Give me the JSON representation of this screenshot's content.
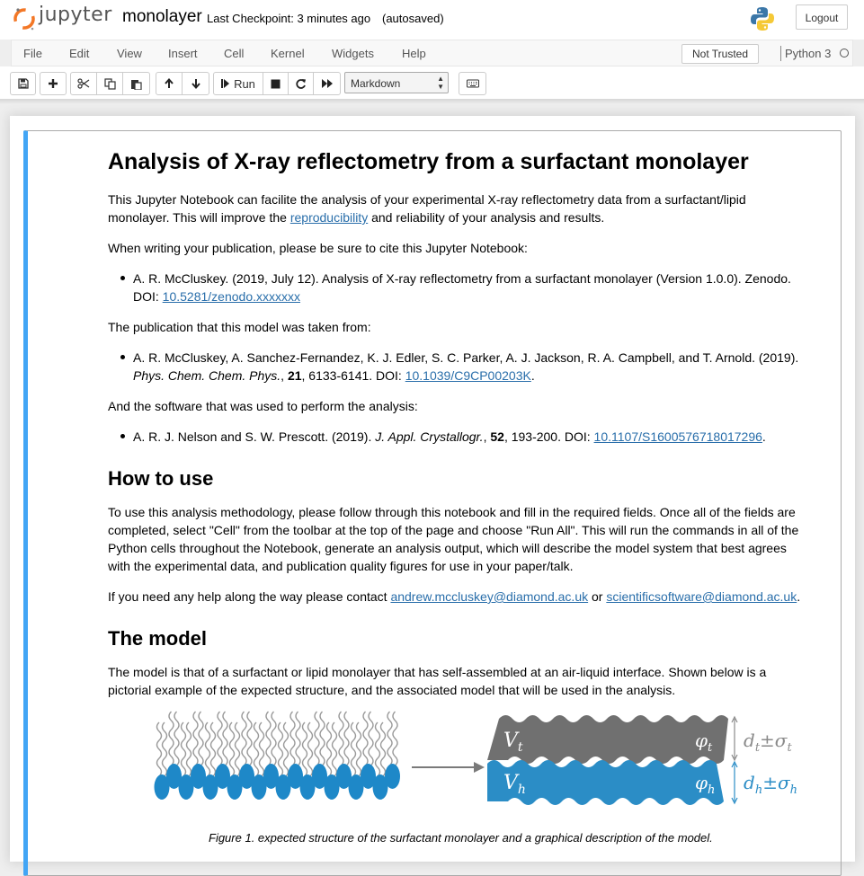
{
  "header": {
    "logo_text": "jupyter",
    "notebook_name": "monolayer",
    "checkpoint": "Last Checkpoint: 3 minutes ago",
    "autosave": "(autosaved)",
    "logout_label": "Logout"
  },
  "menubar": {
    "items": [
      "File",
      "Edit",
      "View",
      "Insert",
      "Cell",
      "Kernel",
      "Widgets",
      "Help"
    ],
    "trusted_label": "Not Trusted",
    "kernel_name": "Python 3"
  },
  "toolbar": {
    "run_label": "Run",
    "cell_type": "Markdown",
    "icons": [
      "save-icon",
      "add-cell-icon",
      "cut-icon",
      "copy-icon",
      "paste-icon",
      "move-up-icon",
      "move-down-icon",
      "run-icon",
      "stop-icon",
      "restart-icon",
      "fast-forward-icon",
      "keyboard-icon"
    ]
  },
  "markdown": {
    "title": "Analysis of X-ray reflectometry from a surfactant monolayer",
    "intro_a": "This Jupyter Notebook can facilite the analysis of your experimental X-ray reflectometry data from a surfactant/lipid",
    "intro_b_pre": "monolayer. This will improve the ",
    "intro_link": "reproducibility",
    "intro_b_post": " and reliability of your analysis and results.",
    "cite_intro": "When writing your publication, please be sure to cite this Jupyter Notebook:",
    "cite1_a": "A. R. McCluskey. (2019, July 12). Analysis of X-ray reflectometry from a surfactant monolayer (Version 1.0.0). Zenodo.",
    "cite1_b_pre": "DOI: ",
    "cite1_doi": "10.5281/zenodo.xxxxxxx",
    "model_intro": "The publication that this model was taken from:",
    "cite2_a": "A. R. McCluskey, A. Sanchez-Fernandez, K. J. Edler, S. C. Parker, A. J. Jackson, R. A. Campbell, and T. Arnold. (2019).",
    "cite2_journal": "Phys. Chem. Chem. Phys.",
    "cite2_sep": ", ",
    "cite2_vol": "21",
    "cite2_pages": ", 6133-6141. DOI: ",
    "cite2_doi": "10.1039/C9CP00203K",
    "cite2_end": ".",
    "software_intro": "And the software that was used to perform the analysis:",
    "cite3_pre": "A. R. J. Nelson and S. W. Prescott. (2019). ",
    "cite3_journal": "J. Appl. Crystallogr.",
    "cite3_sep": ", ",
    "cite3_vol": "52",
    "cite3_pages": ", 193-200. DOI: ",
    "cite3_doi": "10.1107/S1600576718017296",
    "cite3_end": ".",
    "howto_heading": "How to use",
    "howto_l1": "To use this analysis methodology, please follow through this notebook and fill in the required fields. Once all of the fields are",
    "howto_l2": "completed, select \"Cell\" from the toolbar at the top of the page and choose \"Run All\". This will run the commands in all of the",
    "howto_l3": "Python cells throughout the Notebook, generate an analysis output, which will describe the model system that best agrees",
    "howto_l4": "with the experimental data, and publication quality figures for use in your paper/talk.",
    "help_pre": "If you need any help along the way please contact ",
    "help_email1": "andrew.mccluskey@diamond.ac.uk",
    "help_mid": " or ",
    "help_email2": "scientificsoftware@diamond.ac.uk",
    "help_end": ".",
    "model_heading": "The model",
    "model_l1": "The model is that of a surfactant or lipid monolayer that has self-assembled at an air-liquid interface. Shown below is a",
    "model_l2": "pictorial example of the expected structure, and the associated model that will be used in the analysis.",
    "figure_caption": "Figure 1. expected structure of the surfactant monolayer and a graphical description of the model.",
    "figure_labels": {
      "tail_volume": "V",
      "tail_volume_sub": "t",
      "head_volume": "V",
      "head_volume_sub": "h",
      "tail_phi": "φ",
      "tail_phi_sub": "t",
      "head_phi": "φ",
      "head_phi_sub": "h",
      "tail_thickness": "d",
      "tail_thickness_sub": "t",
      "tail_pm": "±σ",
      "tail_sigma_sub": "t",
      "head_thickness": "d",
      "head_thickness_sub": "h",
      "head_pm": "±σ",
      "head_sigma_sub": "h"
    },
    "colors": {
      "link": "#296eaa",
      "cell_border_selected": "#42a5f5",
      "tail_layer": "#707070",
      "head_layer": "#2b8dc6",
      "headgroup": "#1e88c8"
    }
  }
}
